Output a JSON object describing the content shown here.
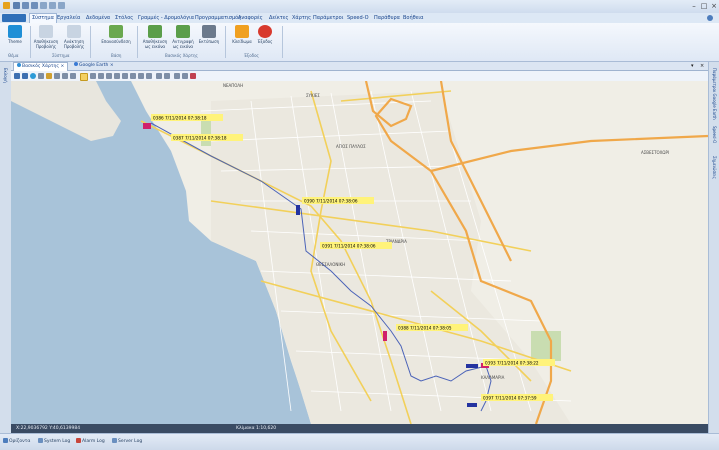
{
  "menubar": {
    "items": [
      "Σύστημα",
      "Εργαλεία",
      "Δεδομένα",
      "Στόλος",
      "Γραμμές - Δρομολόγια",
      "Προγραμματισμός",
      "Αναφορές",
      "Δείκτες",
      "Χάρτης",
      "Παράμετροι",
      "Speed-O",
      "Παράθυρα",
      "Βοήθεια"
    ]
  },
  "ribbon": {
    "buttons": [
      {
        "label": "Theme",
        "color": "#1f8fd6"
      },
      {
        "label": "Αποθήκευση Προβολής",
        "color": "#c8d4e2"
      },
      {
        "label": "Ανάκτηση Προβολής",
        "color": "#c8d4e2"
      },
      {
        "label": "Επανασύνδεση",
        "color": "#6aa84f"
      },
      {
        "label": "Αποθήκευση ως εικόνα",
        "color": "#5b9e4a"
      },
      {
        "label": "Αντιγραφή ως εικόνα",
        "color": "#5b9e4a"
      },
      {
        "label": "Εκτύπωση",
        "color": "#6c7a8c"
      },
      {
        "label": "Κλείδωμα",
        "color": "#f0a020"
      },
      {
        "label": "Έξοδος",
        "color": "#d83a2e"
      }
    ],
    "groups": [
      "Θέμα",
      "Σύστημα",
      "Βάση",
      "Βασικός Χάρτης",
      "Έξοδος"
    ]
  },
  "tabs": [
    "Βασικός Χάρτης",
    "Google Earth"
  ],
  "left_panel": {
    "label": "Εκλογή"
  },
  "right_panel": {
    "labels": [
      "Παράμετροι Google Earth",
      "Speed-O",
      "Σημειώσεις"
    ]
  },
  "map": {
    "places": [
      "ΝΕΑΠΟΛΗ",
      "ΣΥΚΙΕΣ",
      "ΑΓΙΟΣ ΠΑΥΛΟΣ",
      "ΑΣΒΕΣΤΟΧΩΡΙ",
      "ΤΡΙΑΝΔΡΙΑ",
      "ΘΕΣΣΑΛΟΝΙΚΗ",
      "ΚΑΛΑΜΑΡΙΑ"
    ],
    "vehicle_labels": [
      "0386 7/11/2014 07:38:18",
      "0387 7/11/2014 07:38:18",
      "0390 7/11/2014 07:38:06",
      "0391 7/11/2014 07:38:06",
      "0388 7/11/2014 07:38:05",
      "0393 7/11/2014 07:38:22",
      "0397 7/11/2014 07:37:59"
    ]
  },
  "coords": {
    "position": "X:22,9036792 Y:40,6139984",
    "scale": "Κλίμακα 1:10,620"
  },
  "status": {
    "items": [
      "Ορίζοντα",
      "System Log",
      "Alarm Log",
      "Server Log"
    ]
  }
}
